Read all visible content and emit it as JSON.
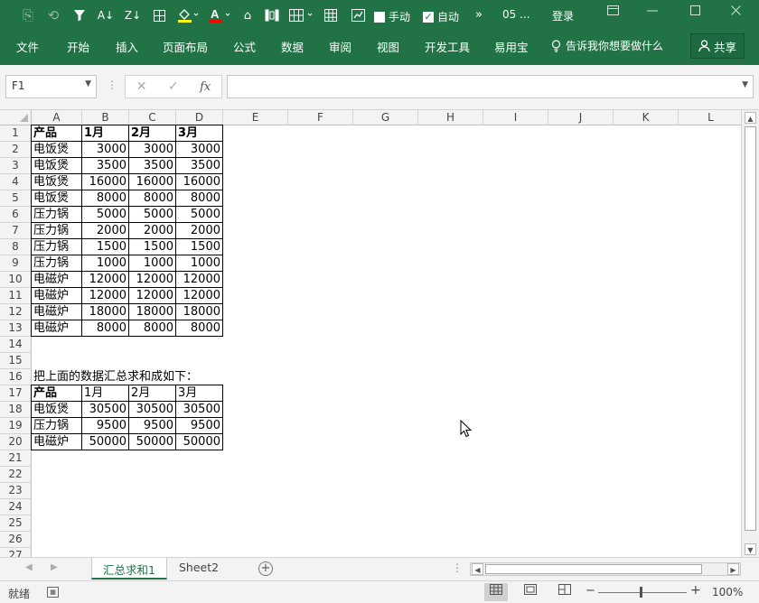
{
  "titlebar": {
    "manual_label": "手动",
    "auto_label": "自动",
    "more_glyph": "»",
    "file_name": "05 ...",
    "login_label": "登录"
  },
  "ribbon": {
    "tabs": [
      "文件",
      "开始",
      "插入",
      "页面布局",
      "公式",
      "数据",
      "审阅",
      "视图",
      "开发工具",
      "易用宝"
    ],
    "tell_me": "告诉我你想要做什么",
    "share": "共享"
  },
  "formula_bar": {
    "name_box": "F1",
    "cancel_glyph": "✕",
    "enter_glyph": "✓",
    "fx_label": "fx",
    "formula": ""
  },
  "grid": {
    "columns": [
      "A",
      "B",
      "C",
      "D",
      "E",
      "F",
      "G",
      "H",
      "I",
      "J",
      "K",
      "L"
    ],
    "rows": [
      "1",
      "2",
      "3",
      "4",
      "5",
      "6",
      "7",
      "8",
      "9",
      "10",
      "11",
      "12",
      "13",
      "14",
      "15",
      "16",
      "17",
      "18",
      "19",
      "20",
      "21",
      "22",
      "23",
      "24",
      "25",
      "26",
      "27"
    ],
    "table1": {
      "headers": [
        "产品",
        "1月",
        "2月",
        "3月"
      ],
      "rows": [
        [
          "电饭煲",
          "3000",
          "3000",
          "3000"
        ],
        [
          "电饭煲",
          "3500",
          "3500",
          "3500"
        ],
        [
          "电饭煲",
          "16000",
          "16000",
          "16000"
        ],
        [
          "电饭煲",
          "8000",
          "8000",
          "8000"
        ],
        [
          "压力锅",
          "5000",
          "5000",
          "5000"
        ],
        [
          "压力锅",
          "2000",
          "2000",
          "2000"
        ],
        [
          "压力锅",
          "1500",
          "1500",
          "1500"
        ],
        [
          "压力锅",
          "1000",
          "1000",
          "1000"
        ],
        [
          "电磁炉",
          "12000",
          "12000",
          "12000"
        ],
        [
          "电磁炉",
          "12000",
          "12000",
          "12000"
        ],
        [
          "电磁炉",
          "18000",
          "18000",
          "18000"
        ],
        [
          "电磁炉",
          "8000",
          "8000",
          "8000"
        ]
      ]
    },
    "note": "把上面的数据汇总求和成如下：",
    "table2": {
      "headers": [
        "产品",
        "1月",
        "2月",
        "3月"
      ],
      "rows": [
        [
          "电饭煲",
          "30500",
          "30500",
          "30500"
        ],
        [
          "压力锅",
          "9500",
          "9500",
          "9500"
        ],
        [
          "电磁炉",
          "50000",
          "50000",
          "50000"
        ]
      ]
    }
  },
  "sheets": {
    "tabs": [
      "汇总求和1",
      "Sheet2"
    ],
    "active": "汇总求和1",
    "add_glyph": "+"
  },
  "status": {
    "ready": "就绪",
    "zoom": "100%",
    "zoom_fraction": 0.5
  },
  "colors": {
    "brand": "#217346",
    "header_bg": "#f3f3f3"
  }
}
